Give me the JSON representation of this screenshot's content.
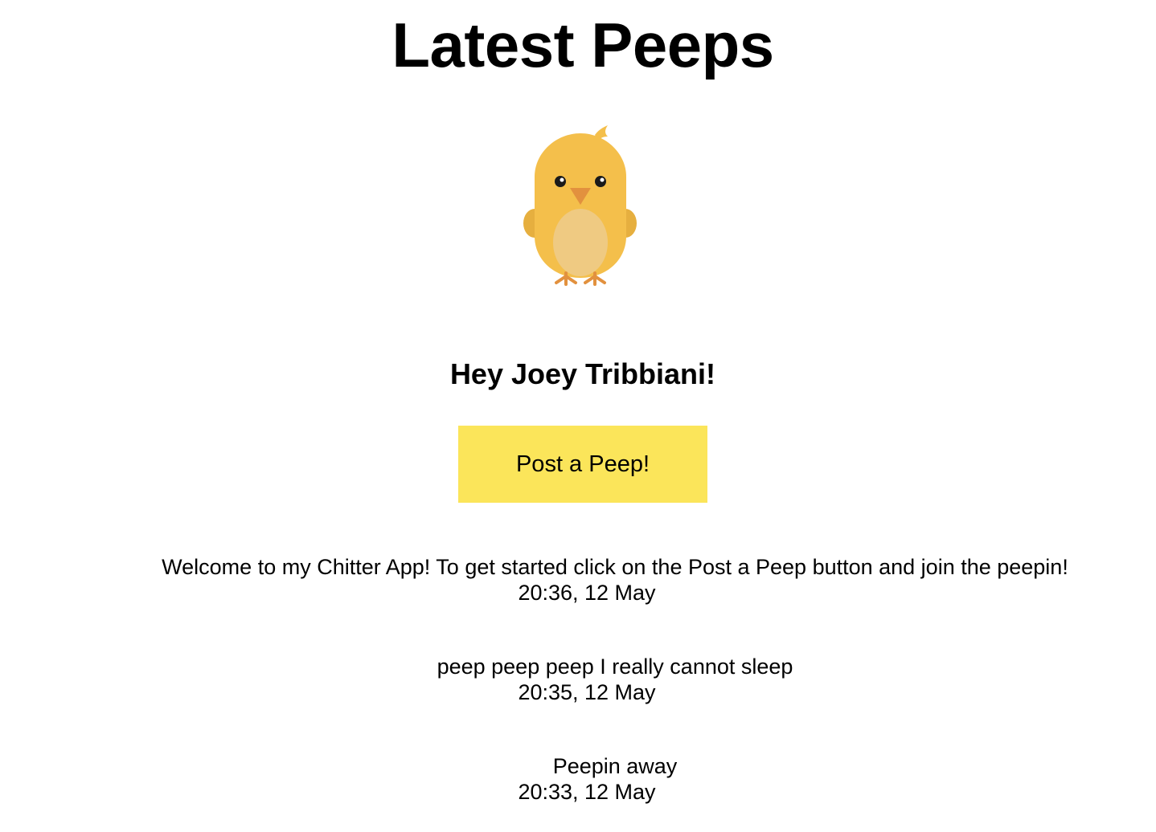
{
  "header": {
    "title": "Latest Peeps"
  },
  "logo": {
    "icon": "chick-icon",
    "colors": {
      "body": "#f4bf4b",
      "belly": "#efca82",
      "beak": "#e2913e",
      "feet": "#e2913e"
    }
  },
  "greeting": "Hey Joey Tribbiani!",
  "post_button": {
    "label": "Post a Peep!",
    "color": "#fbe55a"
  },
  "peeps": [
    {
      "text": "Welcome to my Chitter App! To get started click on the Post a Peep button and join the peepin!",
      "time": "20:36, 12 May"
    },
    {
      "text": "peep peep peep I really cannot sleep",
      "time": "20:35, 12 May"
    },
    {
      "text": "Peepin away",
      "time": "20:33, 12 May"
    }
  ]
}
